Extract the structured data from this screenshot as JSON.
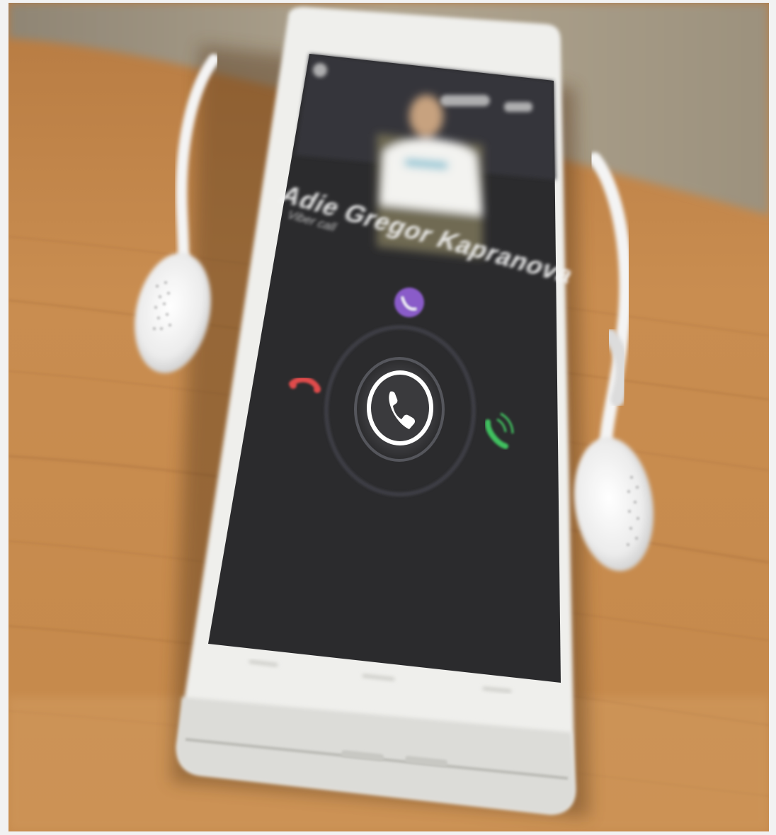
{
  "scene": {
    "description_kind": "photo",
    "colors": {
      "table": "#c9894a",
      "wall": "#a89b86",
      "phone_body": "#f1f1ef",
      "screen": "#2b2b2d",
      "decline": "#e04b4b",
      "accept": "#3fbf5f",
      "app_accent": "#8a5cc9"
    },
    "icons": [
      "viber-icon",
      "decline-call-icon",
      "answer-call-icon",
      "phone-handset-icon"
    ]
  },
  "call_screen": {
    "caller_name": "Adie Gregor Kapranova",
    "caller_status": "Viber call"
  }
}
